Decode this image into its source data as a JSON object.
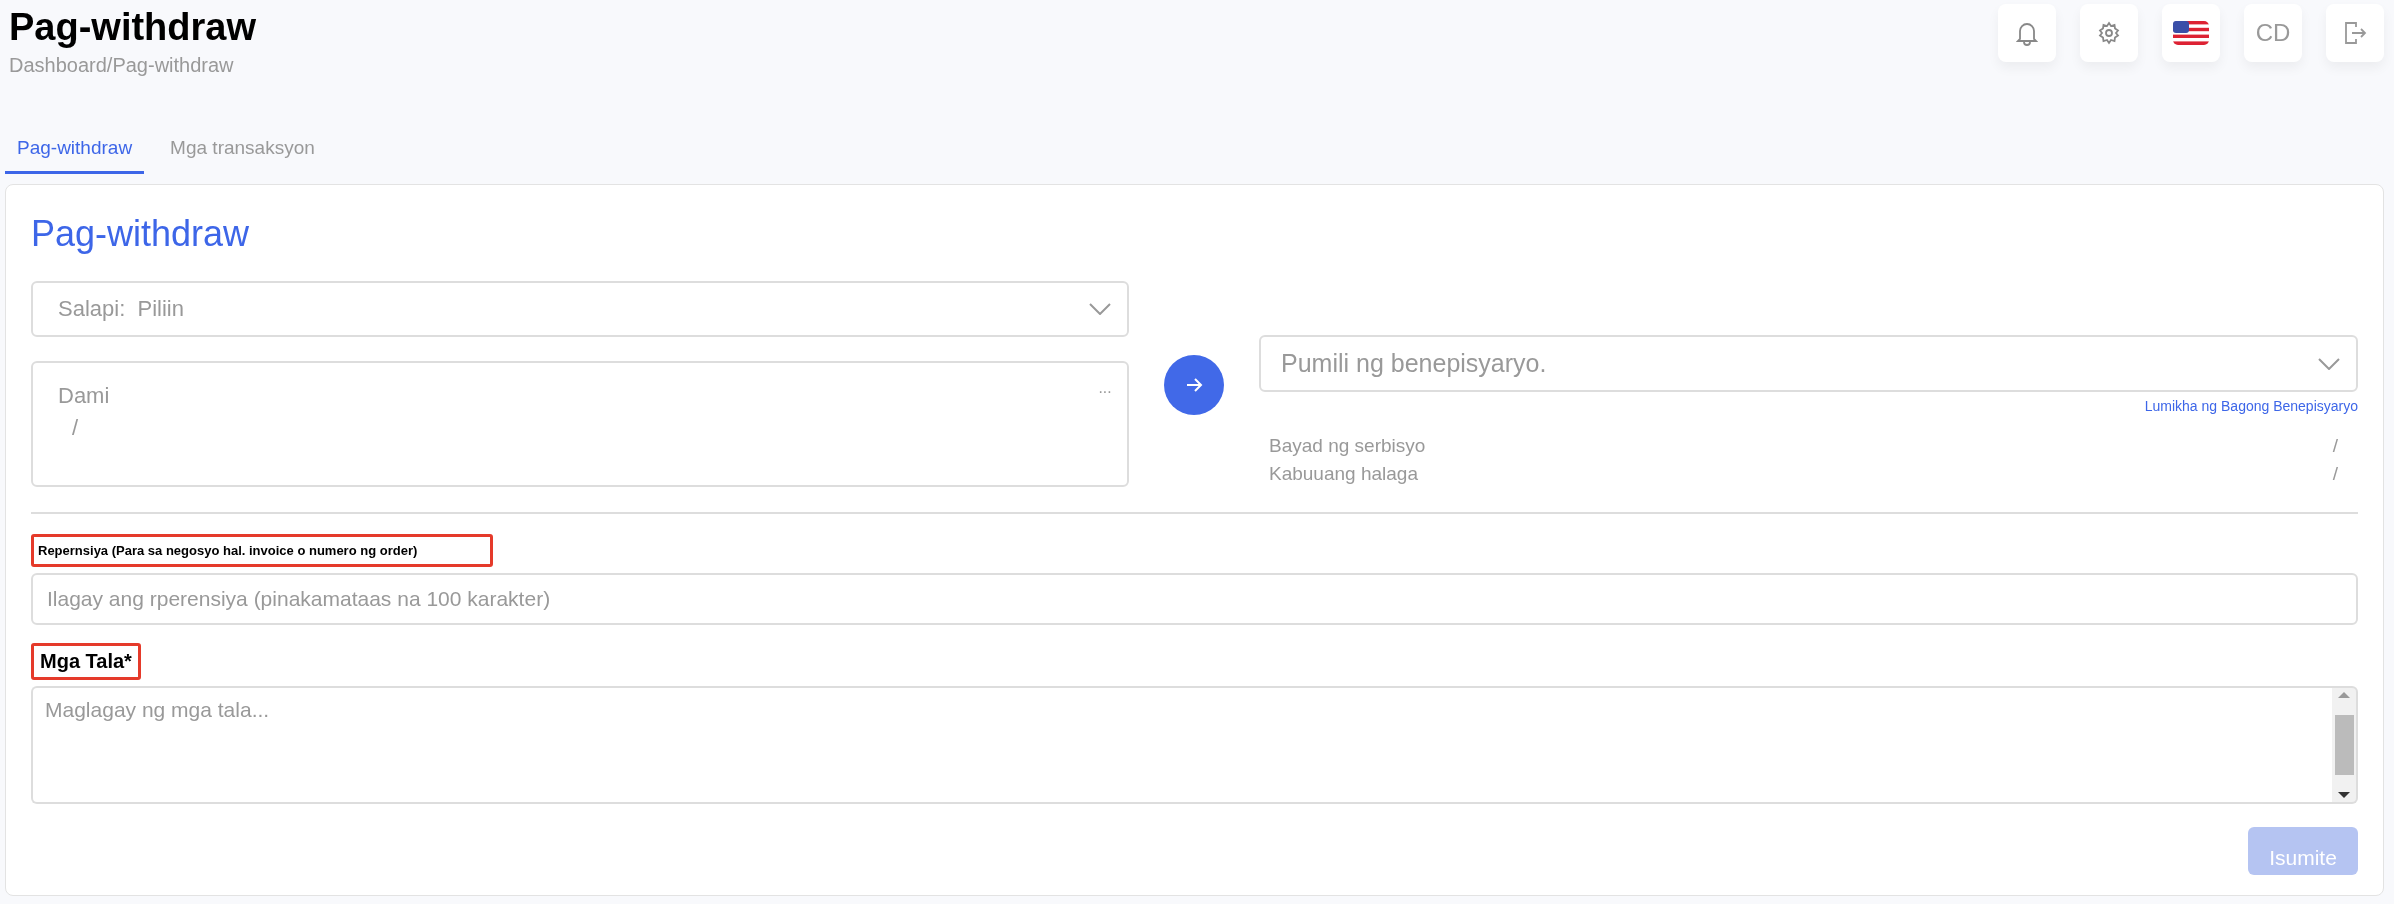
{
  "header": {
    "title": "Pag-withdraw",
    "breadcrumb": "Dashboard/Pag-withdraw",
    "user_initials": "CD"
  },
  "tabs": [
    {
      "label": "Pag-withdraw",
      "selected": true
    },
    {
      "label": "Mga transaksyon",
      "selected": false
    }
  ],
  "form": {
    "title": "Pag-withdraw",
    "currency_select": {
      "label": "Salapi:",
      "value": "Piliin"
    },
    "amount": {
      "label": "Dami",
      "value": "/",
      "menu": "···"
    },
    "beneficiary_select": {
      "placeholder": "Pumili ng benepisyaryo."
    },
    "create_beneficiary_link": "Lumikha ng Bagong Benepisyaryo",
    "summary": [
      {
        "label": "Bayad ng serbisyo",
        "value": "/"
      },
      {
        "label": "Kabuuang halaga",
        "value": "/"
      }
    ],
    "reference": {
      "label": "Repernsiya (Para sa negosyo hal. invoice o numero ng order)",
      "highlighted": true,
      "placeholder": "Ilagay ang rperensiya (pinakamataas na 100 karakter)"
    },
    "notes": {
      "label": "Mga Tala*",
      "highlighted": true,
      "placeholder": "Maglagay ng mga tala..."
    },
    "submit": {
      "label": "Isumite",
      "disabled": true
    }
  }
}
